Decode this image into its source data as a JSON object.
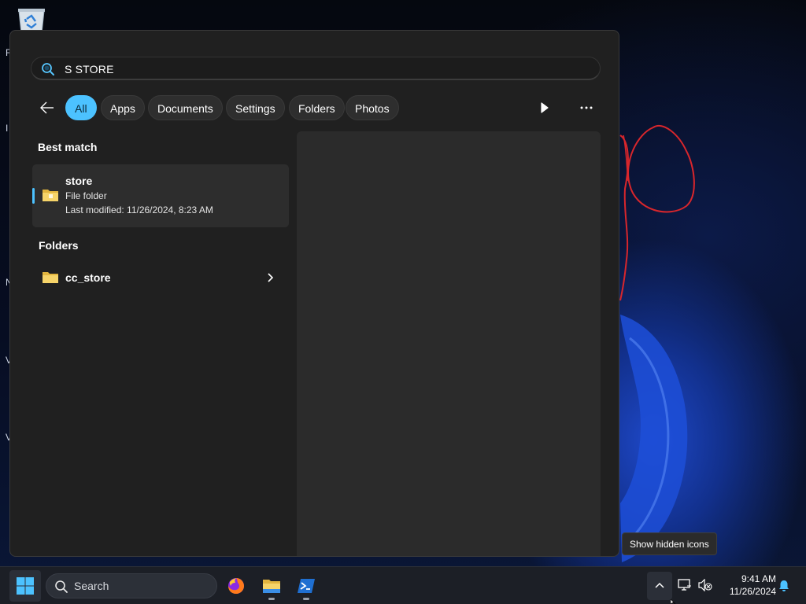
{
  "search": {
    "value": "S STORE",
    "placeholder": ""
  },
  "filters": [
    {
      "label": "All",
      "active": true
    },
    {
      "label": "Apps",
      "active": false
    },
    {
      "label": "Documents",
      "active": false
    },
    {
      "label": "Settings",
      "active": false
    },
    {
      "label": "Folders",
      "active": false
    },
    {
      "label": "Photos",
      "active": false
    }
  ],
  "best_match": {
    "heading": "Best match",
    "name": "store",
    "type": "File folder",
    "modified": "Last modified: 11/26/2024, 8:23 AM"
  },
  "folders": {
    "heading": "Folders",
    "items": [
      {
        "name": "cc_store"
      }
    ]
  },
  "tooltip": {
    "text": "Show hidden icons"
  },
  "taskbar": {
    "search_label": "Search",
    "apps": [
      {
        "icon": "firefox-icon"
      },
      {
        "icon": "file-explorer-icon"
      },
      {
        "icon": "powershell-icon"
      }
    ],
    "time": "9:41 AM",
    "date": "11/26/2024"
  },
  "desktop": {
    "edge_letters": [
      "F",
      "I",
      "N",
      "V",
      "V"
    ]
  },
  "colors": {
    "accent": "#4cc2ff",
    "panel": "#202020",
    "preview": "#2b2b2b",
    "taskbar": "#1c1f26"
  }
}
